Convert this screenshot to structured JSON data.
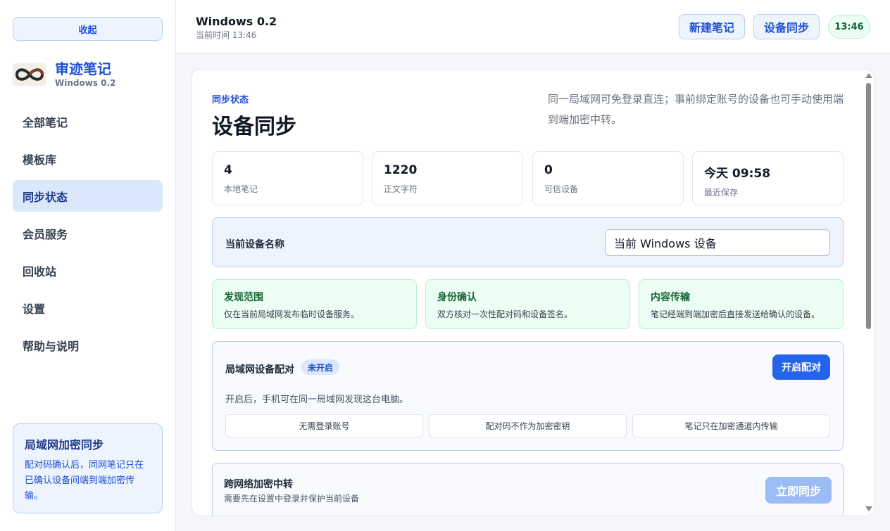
{
  "sidebar": {
    "collapse_label": "收起",
    "brand": {
      "name": "审迹笔记",
      "version": "Windows 0.2"
    },
    "nav_items": [
      {
        "label": "全部笔记",
        "active": false
      },
      {
        "label": "模板库",
        "active": false
      },
      {
        "label": "同步状态",
        "active": true
      },
      {
        "label": "会员服务",
        "active": false
      },
      {
        "label": "回收站",
        "active": false
      },
      {
        "label": "设置",
        "active": false
      },
      {
        "label": "帮助与说明",
        "active": false
      }
    ],
    "info_card": {
      "title": "局域网加密同步",
      "text": "配对码确认后，同网笔记只在已确认设备间端到端加密传输。"
    }
  },
  "header": {
    "title": "Windows 0.2",
    "time_text": "当前时间 13:46",
    "new_note_label": "新建笔记",
    "device_sync_label": "设备同步",
    "clock": "13:46"
  },
  "main": {
    "section_tag": "同步状态",
    "section_title": "设备同步",
    "section_desc": "同一局域网可免登录直连；事前绑定账号的设备也可手动使用端到端加密中转。",
    "stats": [
      {
        "value": "4",
        "label": "本地笔记"
      },
      {
        "value": "1220",
        "label": "正文字符"
      },
      {
        "value": "0",
        "label": "可信设备"
      },
      {
        "value": "今天 09:58",
        "label": "最近保存"
      }
    ],
    "device_name": {
      "label": "当前设备名称",
      "value": "当前 Windows 设备"
    },
    "features": [
      {
        "title": "发现范围",
        "text": "仅在当前局域网发布临时设备服务。"
      },
      {
        "title": "身份确认",
        "text": "双方核对一次性配对码和设备签名。"
      },
      {
        "title": "内容传输",
        "text": "笔记经端到端加密后直接发送给确认的设备。"
      }
    ],
    "pairing": {
      "title": "局域网设备配对",
      "badge": "未开启",
      "button": "开启配对",
      "desc": "开启后，手机可在同一局域网发现这台电脑。",
      "chips": [
        "无需登录账号",
        "配对码不作为加密密钥",
        "笔记只在加密通道内传输"
      ]
    },
    "relay": {
      "title": "跨网络加密中转",
      "subtitle": "需要先在设置中登录并保护当前设备",
      "button": "立即同步"
    }
  },
  "colors": {
    "accent": "#2563eb",
    "accent_soft": "#eef4fd",
    "success_soft": "#ecfdf3",
    "success_text": "#166534"
  }
}
